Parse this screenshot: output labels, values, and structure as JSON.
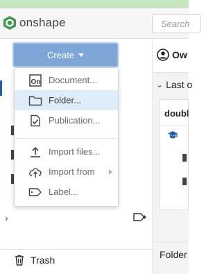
{
  "app": {
    "name": "onshape"
  },
  "search": {
    "placeholder": "Search"
  },
  "toolbar": {
    "create_label": "Create"
  },
  "owner": {
    "label": "Ow"
  },
  "create_menu": {
    "items": [
      {
        "label": "Document...",
        "icon": "document-icon"
      },
      {
        "label": "Folder...",
        "icon": "folder-icon",
        "highlighted": true
      },
      {
        "label": "Publication...",
        "icon": "publication-icon"
      },
      {
        "label": "Import files...",
        "icon": "upload-icon"
      },
      {
        "label": "Import from",
        "icon": "cloud-upload-icon",
        "has_submenu": true
      },
      {
        "label": "Label...",
        "icon": "label-icon"
      }
    ]
  },
  "sidebar": {
    "trash_label": "Trash"
  },
  "main": {
    "section_label": "Last o",
    "card_title": "doubl",
    "folder_row_label": "Folder"
  },
  "colors": {
    "create_button": "#7ea6d6",
    "menu_highlight": "#deedf9",
    "logo_green": "#3e9a55",
    "accent_blue": "#1f5fa8",
    "top_strip": "#c8e6c0"
  }
}
